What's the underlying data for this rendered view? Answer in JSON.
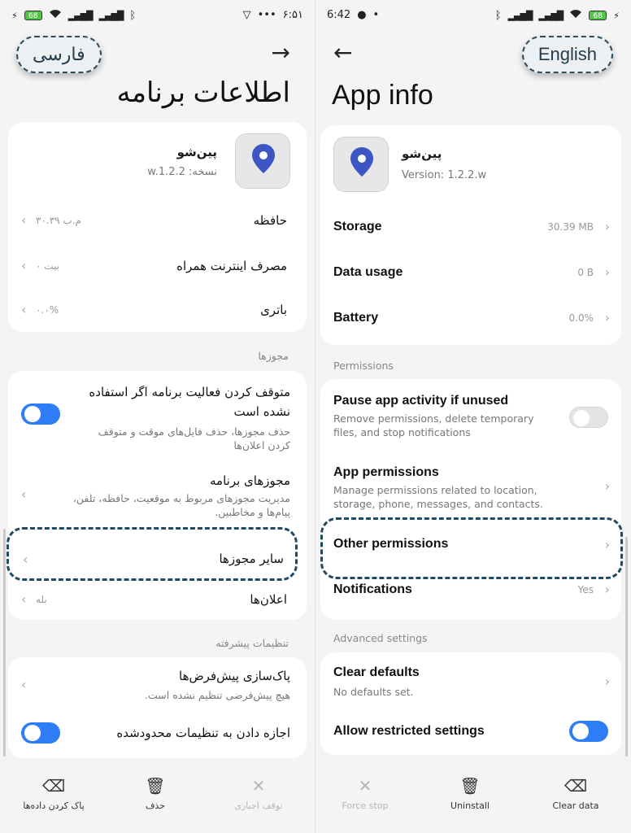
{
  "left": {
    "status": {
      "time": "۶:۵۱",
      "battery": "68"
    },
    "lang_label": "فارسی",
    "title": "اطلاعات برنامه",
    "app": {
      "name": "پین‌شو",
      "version": "نسخه: w.1.2.2"
    },
    "storage": {
      "label": "حافظه",
      "value": "۳۰.۳۹ م.ب"
    },
    "data_usage": {
      "label": "مصرف اینترنت همراه",
      "value": "۰ بیت"
    },
    "battery": {
      "label": "باتری",
      "value": "۰.۰%"
    },
    "permissions_header": "مجوزها",
    "pause": {
      "title": "متوقف کردن فعالیت برنامه اگر استفاده نشده است",
      "sub": "حذف مجوزها، حذف فایل‌های موقت و متوقف کردن اعلان‌ها"
    },
    "app_permissions": {
      "title": "مجوزهای برنامه",
      "sub": "مدیریت مجوزهای مربوط به موقعیت، حافظه، تلفن، پیام‌ها و مخاطبین."
    },
    "other_permissions": {
      "title": "سایر مجوزها"
    },
    "notifications": {
      "label": "اعلان‌ها",
      "value": "بله"
    },
    "advanced_header": "تنظیمات پیشرفته",
    "clear_defaults": {
      "title": "پاک‌سازی پیش‌فرض‌ها",
      "sub": "هیچ پیش‌فرضی تنظیم نشده است."
    },
    "restricted": {
      "title": "اجازه دادن به تنظیمات محدودشده"
    },
    "bottom": {
      "clear_data": "پاک کردن داده‌ها",
      "uninstall": "حذف",
      "force_stop": "توقف اجباری"
    }
  },
  "right": {
    "status": {
      "time": "6:42",
      "battery": "68"
    },
    "lang_label": "English",
    "title": "App info",
    "app": {
      "name": "پین‌شو",
      "version": "Version: 1.2.2.w"
    },
    "storage": {
      "label": "Storage",
      "value": "30.39 MB"
    },
    "data_usage": {
      "label": "Data usage",
      "value": "0 B"
    },
    "battery": {
      "label": "Battery",
      "value": "0.0%"
    },
    "permissions_header": "Permissions",
    "pause": {
      "title": "Pause app activity if unused",
      "sub": "Remove permissions, delete temporary files, and stop notifications"
    },
    "app_permissions": {
      "title": "App permissions",
      "sub": "Manage permissions related to location, storage, phone, messages, and contacts."
    },
    "other_permissions": {
      "title": "Other permissions"
    },
    "notifications": {
      "label": "Notifications",
      "value": "Yes"
    },
    "advanced_header": "Advanced settings",
    "clear_defaults": {
      "title": "Clear defaults",
      "sub": "No defaults set."
    },
    "restricted": {
      "title": "Allow restricted settings"
    },
    "bottom": {
      "force_stop": "Force stop",
      "uninstall": "Uninstall",
      "clear_data": "Clear data"
    }
  },
  "colors": {
    "accent": "#2f7df6",
    "dash": "#1f4a63",
    "pin": "#3d56c4"
  }
}
